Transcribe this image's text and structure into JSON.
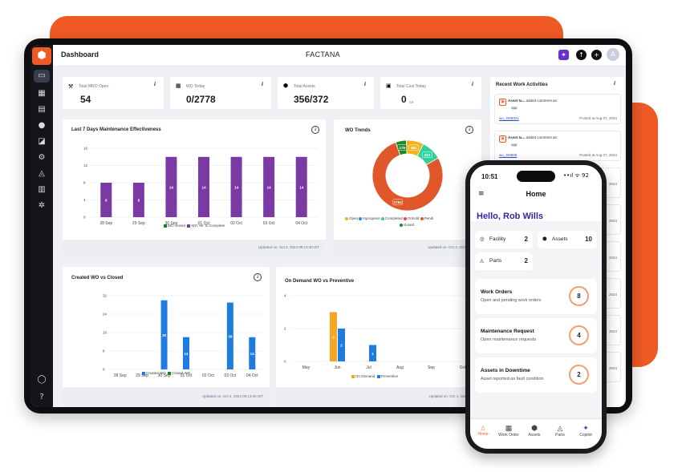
{
  "app": {
    "page_title": "Dashboard",
    "brand": "FACTANA",
    "avatar": "A"
  },
  "kpis": [
    {
      "label": "Total MRO Open",
      "value": "54"
    },
    {
      "label": "WO Today",
      "value": "0/2778"
    },
    {
      "label": "Total Assets",
      "value": "356/372"
    },
    {
      "label": "Total Cost Today",
      "value": "0",
      "unit": "SR"
    }
  ],
  "info_glyph": "i",
  "maintenance_chart": {
    "title": "Last 7 Days Maintenance Effectiveness",
    "updated": "Updated on: Oct 4, 2024 09:13:40 IST",
    "legend": [
      "WO closed",
      "WO Yet To Complete"
    ]
  },
  "wo_trends": {
    "title": "WO Trends",
    "updated": "Updated on: Oct 4, 2024 09:13:",
    "legend": [
      "Open",
      "Inprogress",
      "Completed",
      "Onhold",
      "Pendi",
      "closed"
    ]
  },
  "created_chart": {
    "title": "Created WO vs Closed",
    "updated": "Updated on: Oct 4, 2024 09:13:40 IST",
    "legend": [
      "Created WO",
      "Closed WO"
    ]
  },
  "ondemand_chart": {
    "title": "On Demand WO vs Preventive",
    "updated": "Updated on: Oct 4, 2024 09:13",
    "legend": [
      "On Demand",
      "Preventive"
    ]
  },
  "activities": {
    "title": "Recent Work Activities",
    "items": [
      {
        "who": "Asset ta...",
        "action": "added comment as:",
        "msg": "opp",
        "link": "wo_3r00021",
        "posted": "Posted at Aug 07, 2024"
      },
      {
        "who": "Asset ta...",
        "action": "added comment as:",
        "msg": "opp",
        "link": "wo_3r0000",
        "posted": "Posted at Aug 07, 2024"
      }
    ],
    "partial_dates": [
      "2024",
      "2024",
      "2024",
      "2024",
      "2024",
      "2024"
    ]
  },
  "phone": {
    "time": "10:51",
    "status": "••ıl ᯤ 92",
    "title": "Home",
    "greeting": "Hello, Rob Wills",
    "stats": [
      {
        "label": "Facility",
        "value": "2"
      },
      {
        "label": "Assets",
        "value": "10"
      },
      {
        "label": "Parts",
        "value": "2"
      }
    ],
    "cards": [
      {
        "title": "Work Orders",
        "subtitle": "Open and pending work orders",
        "value": "8"
      },
      {
        "title": "Maintenance Request",
        "subtitle": "Open maintenance requests",
        "value": "4"
      },
      {
        "title": "Assets in Downtime",
        "subtitle": "Asset reported as fault condition",
        "value": "2"
      }
    ],
    "nav": [
      "Home",
      "Work Order",
      "Assets",
      "Parts",
      "Copilot"
    ]
  },
  "chart_data": [
    {
      "type": "bar",
      "title": "Last 7 Days Maintenance Effectiveness",
      "categories": [
        "28 Sep",
        "29 Sep",
        "30 Sep",
        "01 Oct",
        "02 Oct",
        "03 Oct",
        "04 Oct"
      ],
      "series": [
        {
          "name": "WO closed",
          "values": [
            0,
            0,
            0,
            0,
            0,
            0,
            0
          ],
          "color": "#1a7f2a"
        },
        {
          "name": "WO Yet To Complete",
          "values": [
            8,
            8,
            14,
            14,
            14,
            14,
            14
          ],
          "color": "#7b3aa3"
        }
      ],
      "yticks": [
        0,
        4,
        8,
        12,
        16
      ],
      "ylim": [
        0,
        16
      ]
    },
    {
      "type": "pie",
      "title": "WO Trends",
      "donut": true,
      "slices": [
        {
          "label": "Open",
          "value": 282,
          "color": "#f2b21b"
        },
        {
          "label": "Inprogress",
          "value": 0,
          "color": "#2b8be0"
        },
        {
          "label": "Completed",
          "value": 333,
          "color": "#2ed196"
        },
        {
          "label": "Onhold",
          "value": 0,
          "color": "#e8455a"
        },
        {
          "label": "Pendi",
          "value": 2764,
          "color": "#e0582a"
        },
        {
          "label": "closed",
          "value": 179,
          "color": "#1e8a2a"
        }
      ]
    },
    {
      "type": "bar",
      "title": "Created WO vs Closed",
      "categories": [
        "28 Sep",
        "29 Sep",
        "30 Sep",
        "01 Oct",
        "02 Oct",
        "03 Oct",
        "04 Oct"
      ],
      "series": [
        {
          "name": "Created WO",
          "values": [
            0,
            0,
            30,
            14,
            0,
            29,
            14
          ],
          "color": "#1e7be0"
        },
        {
          "name": "Closed WO",
          "values": [
            0,
            0,
            0,
            0,
            0,
            0,
            0
          ],
          "color": "#1a7f2a"
        }
      ],
      "ylim": [
        0,
        32
      ],
      "ytick_labels": [
        "0",
        "8",
        "16",
        "24",
        "32"
      ]
    },
    {
      "type": "bar",
      "title": "On Demand WO vs Preventive",
      "categories": [
        "May",
        "Jun",
        "Jul",
        "Aug",
        "Sep",
        "Oct"
      ],
      "series": [
        {
          "name": "On Demand",
          "values": [
            0,
            3,
            0,
            0,
            0,
            0
          ],
          "color": "#f5a623"
        },
        {
          "name": "Preventive",
          "values": [
            0,
            2,
            1,
            0,
            0,
            0
          ],
          "color": "#1e7be0"
        }
      ],
      "yticks": [
        0,
        2,
        4
      ],
      "ylim": [
        0,
        4
      ]
    }
  ]
}
